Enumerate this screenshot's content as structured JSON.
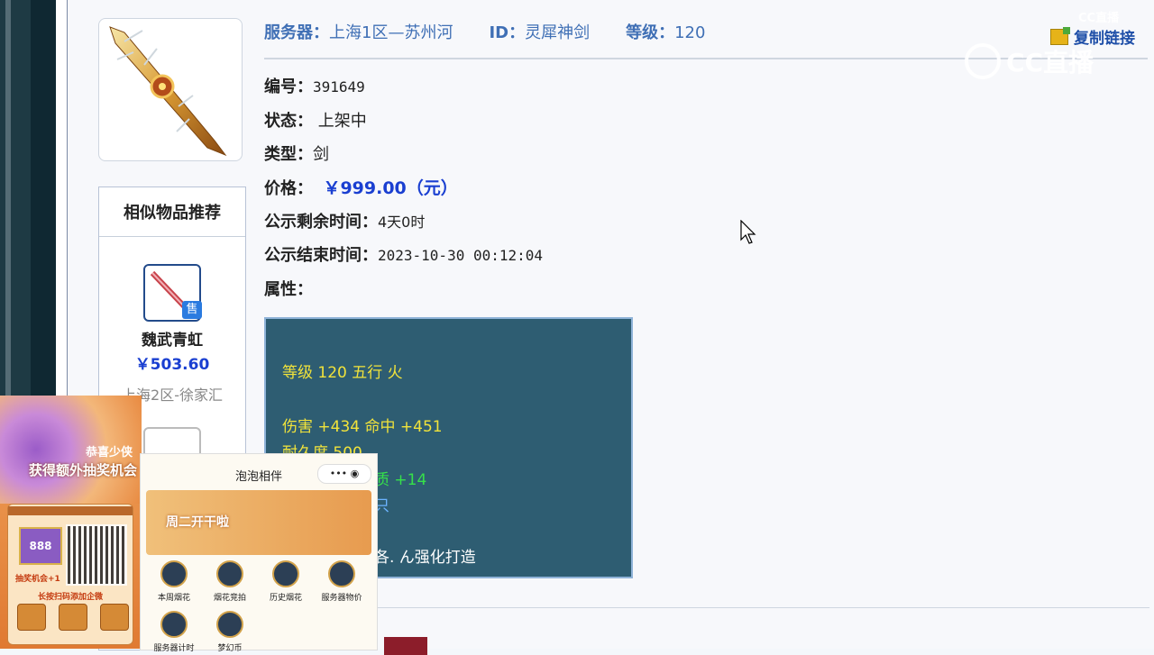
{
  "header": {
    "server_label": "服务器：",
    "server_value": "上海1区—苏州河",
    "id_label": "ID：",
    "id_value": "灵犀神剑",
    "level_label": "等级：",
    "level_value": "120",
    "copy_link": "复制链接"
  },
  "fields": {
    "number_label": "编号：",
    "number_value": "391649",
    "status_label": "状态：",
    "status_value": "上架中",
    "type_label": "类型：",
    "type_value": "剑",
    "price_label": "价格：",
    "price_value": "￥999.00（元）",
    "remaining_label": "公示剩余时间：",
    "remaining_value": "4天0时",
    "end_label": "公示结束时间：",
    "end_value": "2023-10-30 00:12:04",
    "attr_label": "属性："
  },
  "attributes": {
    "line1": "等级 120 五行 火",
    "line2": "伤害 +434 命中 +451",
    "line3": "耐久度 500",
    "line4": "质 +14",
    "line5": "只",
    "line6": "各. ん强化打造"
  },
  "similar": {
    "title": "相似物品推荐",
    "badge": "售",
    "item1_name": "魏武青虹",
    "item1_price": "￥503.60",
    "item1_server": "上海2区-徐家汇"
  },
  "overlay": {
    "cc_small": "CC直播",
    "cc_logo": "CC直播",
    "promo_title1": "恭喜少侠",
    "promo_title2": "获得额外抽奖机会",
    "promo_value": "888",
    "promo_line1": "抽奖机会+1",
    "promo_line2": "长按扫码添加企微",
    "mini_title": "泡泡相伴",
    "mini_menu": "•••",
    "mini_banner": "周二开干啦",
    "mini_items": [
      "本周烟花",
      "烟花竞拍",
      "历史烟花",
      "服务器物价",
      "服务器计时",
      "梦幻币"
    ]
  }
}
